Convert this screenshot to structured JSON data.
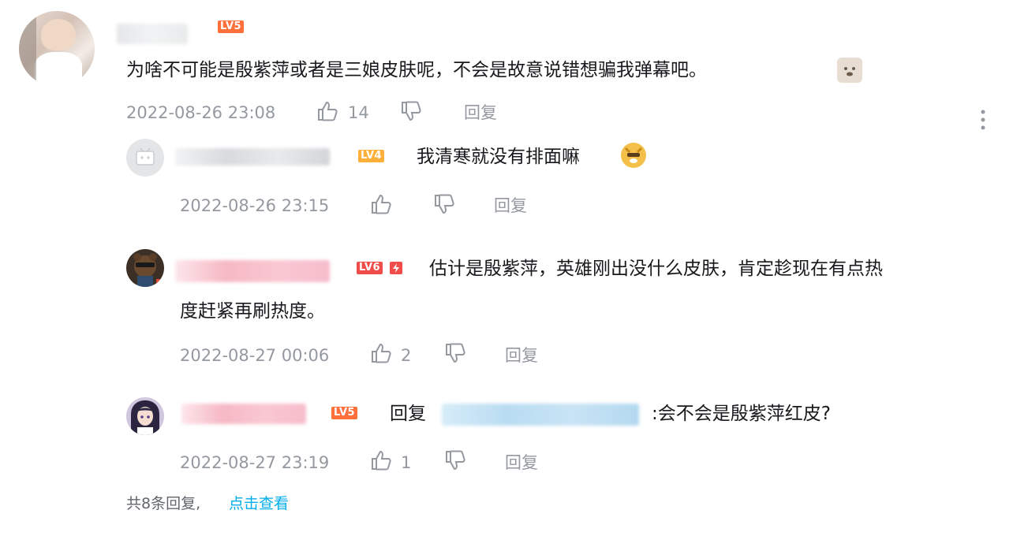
{
  "main_comment": {
    "level": "LV5",
    "text": "为啥不可能是殷紫萍或者是三娘皮肤呢，不会是故意说错想骗我弹幕吧。",
    "time": "2022-08-26 23:08",
    "likes": "14",
    "reply_label": "回复"
  },
  "replies": [
    {
      "level": "LV4",
      "text": "我清寒就没有排面嘛",
      "time": "2022-08-26 23:15",
      "likes": "",
      "reply_label": "回复"
    },
    {
      "level": "LV6",
      "text_line1": "估计是殷紫萍，英雄刚出没什么皮肤，肯定趁现在有点热",
      "text_line2": "度赶紧再刷热度。",
      "time": "2022-08-27 00:06",
      "likes": "2",
      "reply_label": "回复"
    },
    {
      "level": "LV5",
      "reply_prefix": "回复",
      "text": ":会不会是殷紫萍红皮?",
      "time": "2022-08-27 23:19",
      "likes": "1",
      "reply_label": "回复"
    }
  ],
  "footer": {
    "total_text": "共8条回复,",
    "view_link": "点击查看"
  },
  "colors": {
    "level_orange": "#ff6f3c",
    "level_red": "#f04c49",
    "link_blue": "#00aeec",
    "meta_gray": "#9499a0"
  }
}
